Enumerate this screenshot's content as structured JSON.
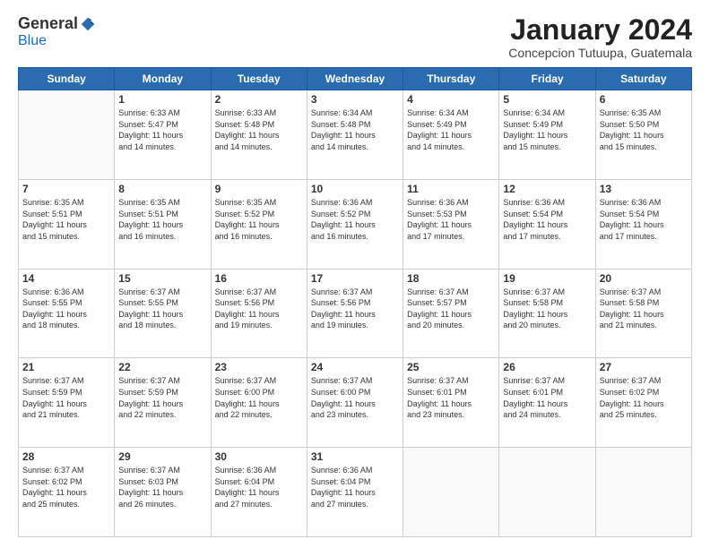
{
  "logo": {
    "general": "General",
    "blue": "Blue"
  },
  "header": {
    "month": "January 2024",
    "location": "Concepcion Tutuupa, Guatemala"
  },
  "days_of_week": [
    "Sunday",
    "Monday",
    "Tuesday",
    "Wednesday",
    "Thursday",
    "Friday",
    "Saturday"
  ],
  "weeks": [
    [
      {
        "day": "",
        "info": ""
      },
      {
        "day": "1",
        "info": "Sunrise: 6:33 AM\nSunset: 5:47 PM\nDaylight: 11 hours\nand 14 minutes."
      },
      {
        "day": "2",
        "info": "Sunrise: 6:33 AM\nSunset: 5:48 PM\nDaylight: 11 hours\nand 14 minutes."
      },
      {
        "day": "3",
        "info": "Sunrise: 6:34 AM\nSunset: 5:48 PM\nDaylight: 11 hours\nand 14 minutes."
      },
      {
        "day": "4",
        "info": "Sunrise: 6:34 AM\nSunset: 5:49 PM\nDaylight: 11 hours\nand 14 minutes."
      },
      {
        "day": "5",
        "info": "Sunrise: 6:34 AM\nSunset: 5:49 PM\nDaylight: 11 hours\nand 15 minutes."
      },
      {
        "day": "6",
        "info": "Sunrise: 6:35 AM\nSunset: 5:50 PM\nDaylight: 11 hours\nand 15 minutes."
      }
    ],
    [
      {
        "day": "7",
        "info": "Sunrise: 6:35 AM\nSunset: 5:51 PM\nDaylight: 11 hours\nand 15 minutes."
      },
      {
        "day": "8",
        "info": "Sunrise: 6:35 AM\nSunset: 5:51 PM\nDaylight: 11 hours\nand 16 minutes."
      },
      {
        "day": "9",
        "info": "Sunrise: 6:35 AM\nSunset: 5:52 PM\nDaylight: 11 hours\nand 16 minutes."
      },
      {
        "day": "10",
        "info": "Sunrise: 6:36 AM\nSunset: 5:52 PM\nDaylight: 11 hours\nand 16 minutes."
      },
      {
        "day": "11",
        "info": "Sunrise: 6:36 AM\nSunset: 5:53 PM\nDaylight: 11 hours\nand 17 minutes."
      },
      {
        "day": "12",
        "info": "Sunrise: 6:36 AM\nSunset: 5:54 PM\nDaylight: 11 hours\nand 17 minutes."
      },
      {
        "day": "13",
        "info": "Sunrise: 6:36 AM\nSunset: 5:54 PM\nDaylight: 11 hours\nand 17 minutes."
      }
    ],
    [
      {
        "day": "14",
        "info": "Sunrise: 6:36 AM\nSunset: 5:55 PM\nDaylight: 11 hours\nand 18 minutes."
      },
      {
        "day": "15",
        "info": "Sunrise: 6:37 AM\nSunset: 5:55 PM\nDaylight: 11 hours\nand 18 minutes."
      },
      {
        "day": "16",
        "info": "Sunrise: 6:37 AM\nSunset: 5:56 PM\nDaylight: 11 hours\nand 19 minutes."
      },
      {
        "day": "17",
        "info": "Sunrise: 6:37 AM\nSunset: 5:56 PM\nDaylight: 11 hours\nand 19 minutes."
      },
      {
        "day": "18",
        "info": "Sunrise: 6:37 AM\nSunset: 5:57 PM\nDaylight: 11 hours\nand 20 minutes."
      },
      {
        "day": "19",
        "info": "Sunrise: 6:37 AM\nSunset: 5:58 PM\nDaylight: 11 hours\nand 20 minutes."
      },
      {
        "day": "20",
        "info": "Sunrise: 6:37 AM\nSunset: 5:58 PM\nDaylight: 11 hours\nand 21 minutes."
      }
    ],
    [
      {
        "day": "21",
        "info": "Sunrise: 6:37 AM\nSunset: 5:59 PM\nDaylight: 11 hours\nand 21 minutes."
      },
      {
        "day": "22",
        "info": "Sunrise: 6:37 AM\nSunset: 5:59 PM\nDaylight: 11 hours\nand 22 minutes."
      },
      {
        "day": "23",
        "info": "Sunrise: 6:37 AM\nSunset: 6:00 PM\nDaylight: 11 hours\nand 22 minutes."
      },
      {
        "day": "24",
        "info": "Sunrise: 6:37 AM\nSunset: 6:00 PM\nDaylight: 11 hours\nand 23 minutes."
      },
      {
        "day": "25",
        "info": "Sunrise: 6:37 AM\nSunset: 6:01 PM\nDaylight: 11 hours\nand 23 minutes."
      },
      {
        "day": "26",
        "info": "Sunrise: 6:37 AM\nSunset: 6:01 PM\nDaylight: 11 hours\nand 24 minutes."
      },
      {
        "day": "27",
        "info": "Sunrise: 6:37 AM\nSunset: 6:02 PM\nDaylight: 11 hours\nand 25 minutes."
      }
    ],
    [
      {
        "day": "28",
        "info": "Sunrise: 6:37 AM\nSunset: 6:02 PM\nDaylight: 11 hours\nand 25 minutes."
      },
      {
        "day": "29",
        "info": "Sunrise: 6:37 AM\nSunset: 6:03 PM\nDaylight: 11 hours\nand 26 minutes."
      },
      {
        "day": "30",
        "info": "Sunrise: 6:36 AM\nSunset: 6:04 PM\nDaylight: 11 hours\nand 27 minutes."
      },
      {
        "day": "31",
        "info": "Sunrise: 6:36 AM\nSunset: 6:04 PM\nDaylight: 11 hours\nand 27 minutes."
      },
      {
        "day": "",
        "info": ""
      },
      {
        "day": "",
        "info": ""
      },
      {
        "day": "",
        "info": ""
      }
    ]
  ]
}
